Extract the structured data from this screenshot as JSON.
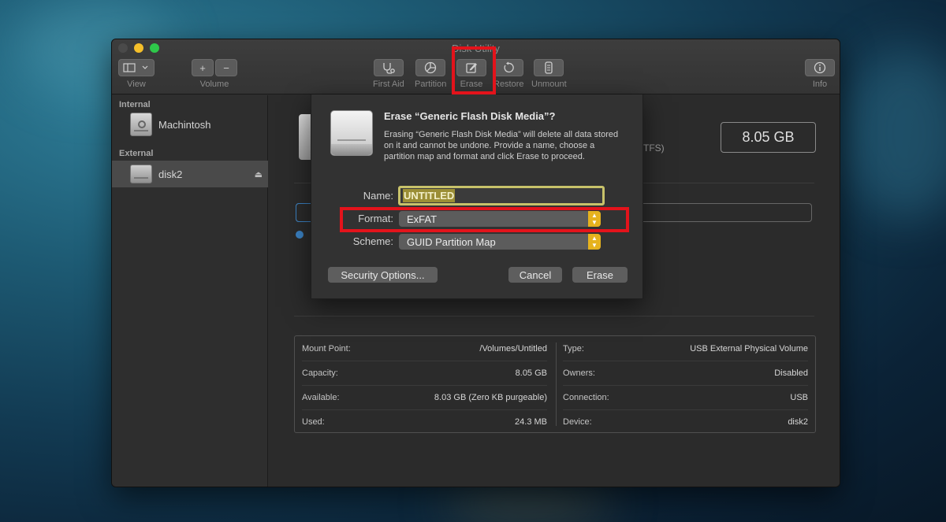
{
  "window": {
    "title": "Disk Utility"
  },
  "toolbar": {
    "view_label": "View",
    "volume_label": "Volume",
    "volume_add": "+",
    "volume_remove": "−",
    "first_aid_label": "First Aid",
    "partition_label": "Partition",
    "erase_label": "Erase",
    "restore_label": "Restore",
    "unmount_label": "Unmount",
    "info_label": "Info"
  },
  "sidebar": {
    "internal_header": "Internal",
    "external_header": "External",
    "items": [
      {
        "label": "Machintosh",
        "section": "Internal"
      },
      {
        "label": "disk2",
        "section": "External",
        "selected": true
      }
    ]
  },
  "main": {
    "format_suffix": "TFS)",
    "capacity_box": "8.05 GB",
    "info": {
      "left": [
        {
          "key": "Mount Point:",
          "value": "/Volumes/Untitled"
        },
        {
          "key": "Capacity:",
          "value": "8.05 GB"
        },
        {
          "key": "Available:",
          "value": "8.03 GB (Zero KB purgeable)"
        },
        {
          "key": "Used:",
          "value": "24.3 MB"
        }
      ],
      "right": [
        {
          "key": "Type:",
          "value": "USB External Physical Volume"
        },
        {
          "key": "Owners:",
          "value": "Disabled"
        },
        {
          "key": "Connection:",
          "value": "USB"
        },
        {
          "key": "Device:",
          "value": "disk2"
        }
      ]
    }
  },
  "erase_sheet": {
    "title": "Erase “Generic Flash Disk Media”?",
    "message": "Erasing “Generic Flash Disk Media” will delete all data stored on it and cannot be undone. Provide a name, choose a partition map and format and click Erase to proceed.",
    "name_label": "Name:",
    "name_value": "UNTITLED",
    "format_label": "Format:",
    "format_value": "ExFAT",
    "scheme_label": "Scheme:",
    "scheme_value": "GUID Partition Map",
    "security_button": "Security Options...",
    "cancel_button": "Cancel",
    "erase_button": "Erase"
  },
  "icons": {
    "view": "sidebar-toggle-icon",
    "first_aid": "stethoscope-icon",
    "partition": "pie-chart-icon",
    "erase": "erase-icon",
    "restore": "restore-icon",
    "unmount": "unmount-icon",
    "info": "info-icon",
    "eject": "eject-icon"
  },
  "colors": {
    "annotation_highlight": "#e3131b",
    "popup_chevron": "#e6b21e",
    "name_focus": "#c8c26a"
  }
}
